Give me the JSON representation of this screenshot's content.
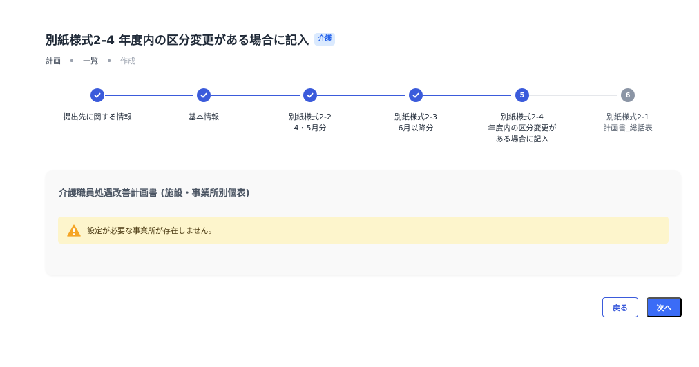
{
  "header": {
    "title": "別紙様式2-4 年度内の区分変更がある場合に記入",
    "badge": "介護"
  },
  "breadcrumb": [
    "計画",
    "一覧",
    "作成"
  ],
  "stepper": {
    "steps": [
      {
        "lines": [
          "提出先に関する情報"
        ],
        "state": "done",
        "number": "1"
      },
      {
        "lines": [
          "基本情報"
        ],
        "state": "done",
        "number": "2"
      },
      {
        "lines": [
          "別紙様式2-2",
          "4・5月分"
        ],
        "state": "done",
        "number": "3"
      },
      {
        "lines": [
          "別紙様式2-3",
          "6月以降分"
        ],
        "state": "done",
        "number": "4"
      },
      {
        "lines": [
          "別紙様式2-4",
          "年度内の区分変更が",
          "ある場合に記入"
        ],
        "state": "active",
        "number": "5"
      },
      {
        "lines": [
          "別紙様式2-1",
          "計画書_総括表"
        ],
        "state": "pending",
        "number": "6"
      }
    ]
  },
  "card": {
    "title": "介護職員処遇改善計画書 (施設・事業所別個表)",
    "alert": {
      "icon": "warning-icon",
      "text": "設定が必要な事業所が存在しません。"
    }
  },
  "actions": {
    "back_label": "戻る",
    "next_label": "次へ"
  },
  "colors": {
    "primary": "#3b5bdb",
    "alert_bg": "#fdf5cc",
    "warning": "#f5a524"
  }
}
